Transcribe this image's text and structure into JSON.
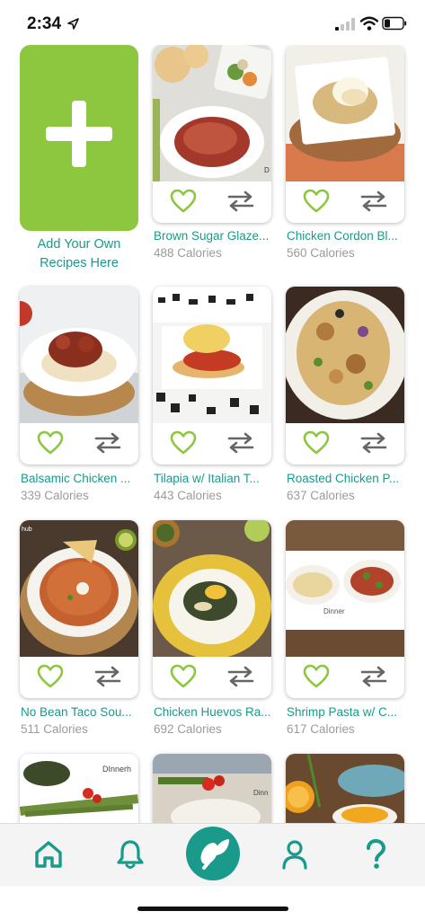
{
  "status_bar": {
    "time": "2:34"
  },
  "add_tile": {
    "label_line1": "Add Your Own",
    "label_line2": "Recipes Here"
  },
  "recipes": [
    {
      "name": "Brown Sugar Glaze...",
      "calories": "488 Calories"
    },
    {
      "name": "Chicken Cordon Bl...",
      "calories": "560 Calories"
    },
    {
      "name": "Balsamic Chicken ...",
      "calories": "339 Calories"
    },
    {
      "name": "Tilapia w/ Italian T...",
      "calories": "443 Calories"
    },
    {
      "name": "Roasted Chicken P...",
      "calories": "637 Calories"
    },
    {
      "name": "No Bean Taco Sou...",
      "calories": "511 Calories"
    },
    {
      "name": "Chicken Huevos Ra...",
      "calories": "692 Calories"
    },
    {
      "name": "Shrimp Pasta w/ C...",
      "calories": "617 Calories"
    }
  ],
  "icons": {
    "favorite": "heart-outline-icon",
    "swap": "swap-arrows-icon",
    "tabs": [
      "home-icon",
      "bell-icon",
      "spoon-leaf-icon",
      "profile-icon",
      "help-icon"
    ]
  },
  "colors": {
    "accent_green": "#8dc63f",
    "teal": "#1a9a8a",
    "calorie_gray": "#9b9b9b"
  }
}
